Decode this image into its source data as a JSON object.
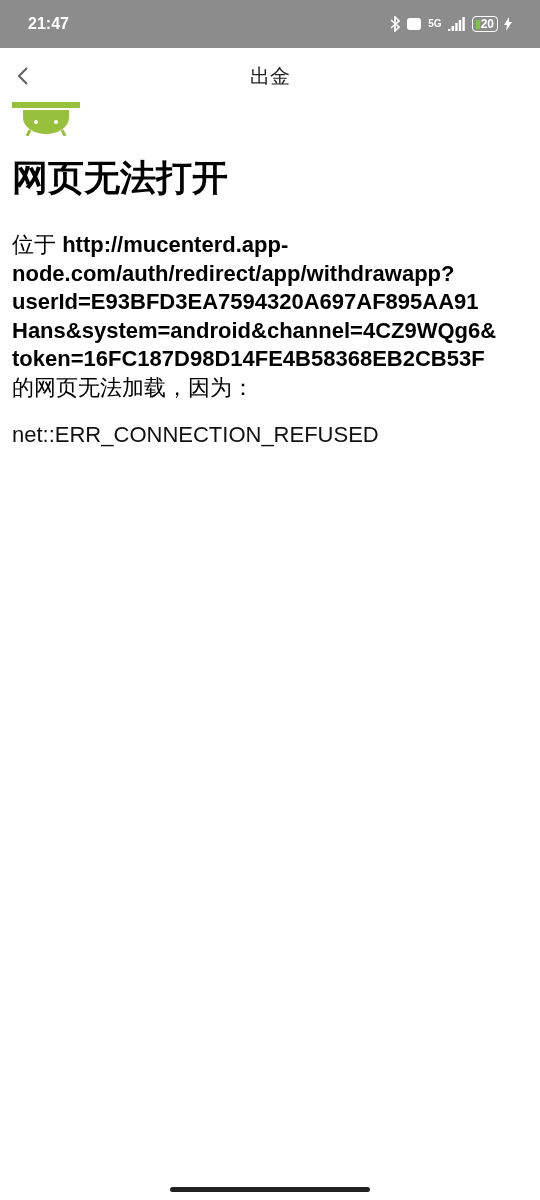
{
  "status_bar": {
    "time": "21:47",
    "network": "5G",
    "battery": "20"
  },
  "header": {
    "title": "出金"
  },
  "error_page": {
    "heading": "网页无法打开",
    "message_lines": [
      "位于 **http://mucenterd.app-**",
      "**node.com/auth/redirect/app/withdrawapp?**",
      "**userId=E93BFD3EA7594320A697AF895AA91**",
      "**Hans&system=android&channel=4CZ9WQg6&**",
      "**token=16FC187D98D14FE4B58368EB2CB53F**",
      "的网页无法加载，因为："
    ],
    "error_code": "net::ERR_CONNECTION_REFUSED"
  }
}
